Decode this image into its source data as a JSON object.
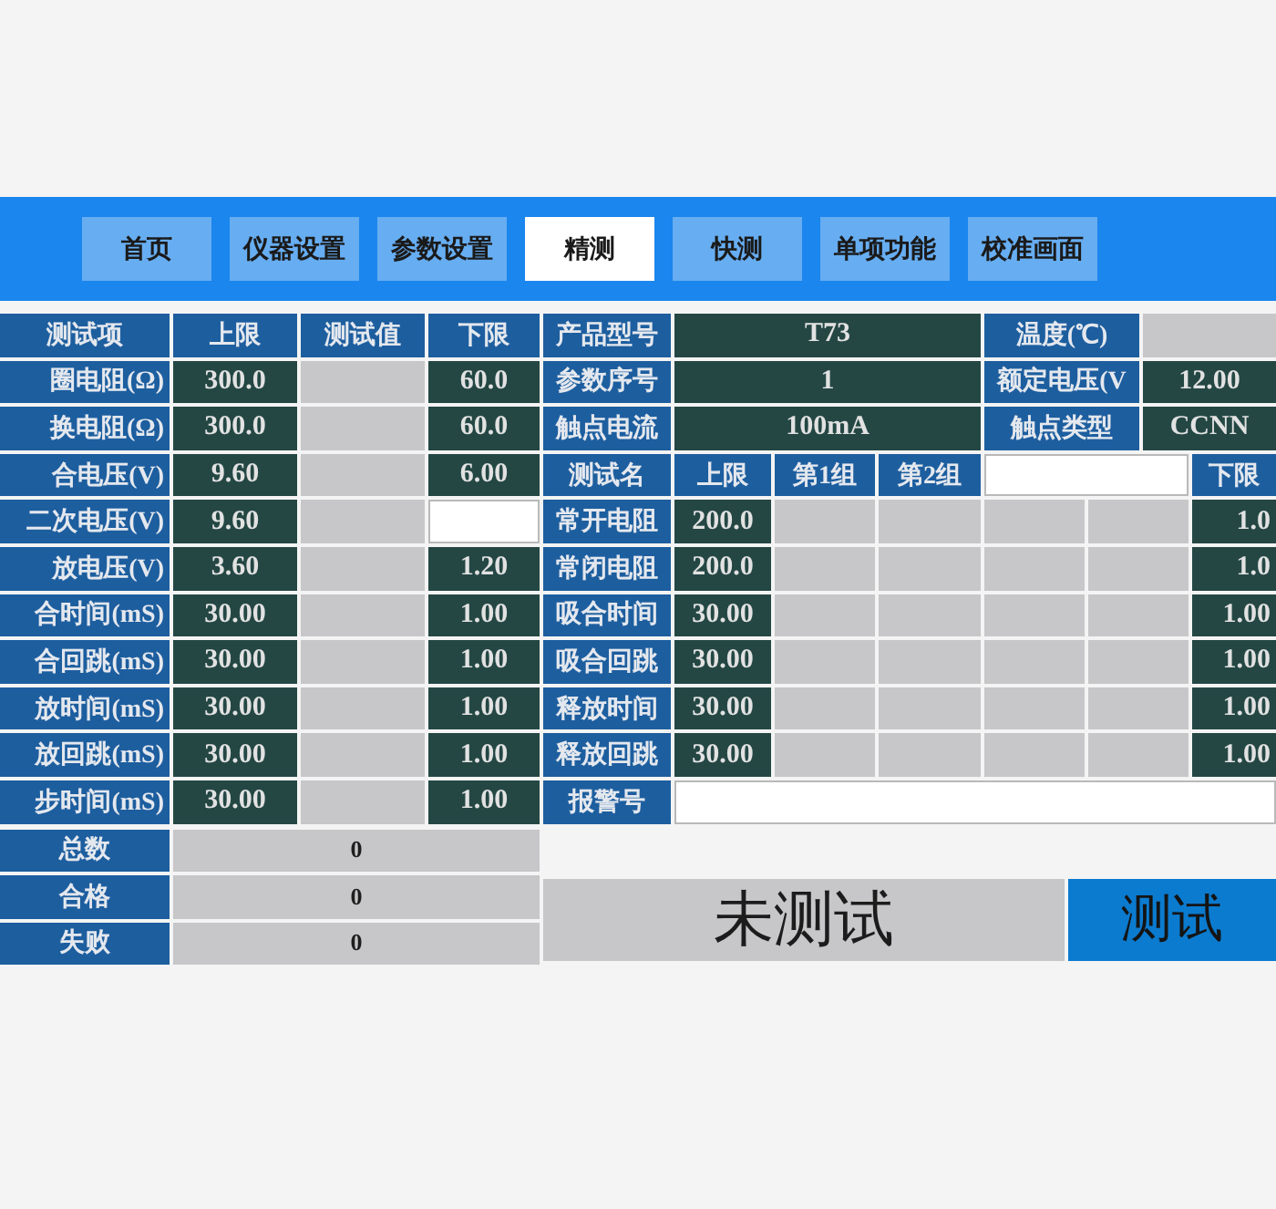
{
  "tabs": [
    {
      "label": "首页",
      "selected": false
    },
    {
      "label": "仪器设置",
      "selected": false
    },
    {
      "label": "参数设置",
      "selected": false
    },
    {
      "label": "精测",
      "selected": true
    },
    {
      "label": "快测",
      "selected": false
    },
    {
      "label": "单项功能",
      "selected": false
    },
    {
      "label": "校准画面",
      "selected": false
    }
  ],
  "limits_table": {
    "columns": [
      "测试项",
      "上限",
      "测试值",
      "下限"
    ],
    "rows": [
      {
        "item": "圈电阻(Ω)",
        "upper": "300.0",
        "lower": "60.0"
      },
      {
        "item": "换电阻(Ω)",
        "upper": "300.0",
        "lower": "60.0"
      },
      {
        "item": "合电压(V)",
        "upper": "9.60",
        "lower": "6.00"
      },
      {
        "item": "二次电压(V)",
        "upper": "9.60"
      },
      {
        "item": "放电压(V)",
        "upper": "3.60",
        "lower": "1.20"
      },
      {
        "item": "合时间(mS)",
        "upper": "30.00",
        "lower": "1.00"
      },
      {
        "item": "合回跳(mS)",
        "upper": "30.00",
        "lower": "1.00"
      },
      {
        "item": "放时间(mS)",
        "upper": "30.00",
        "lower": "1.00"
      },
      {
        "item": "放回跳(mS)",
        "upper": "30.00",
        "lower": "1.00"
      },
      {
        "item": "步时间(mS)",
        "upper": "30.00",
        "lower": "1.00"
      }
    ]
  },
  "summary": [
    {
      "label": "总数",
      "value": "0"
    },
    {
      "label": "合格",
      "value": "0"
    },
    {
      "label": "失败",
      "value": "0"
    }
  ],
  "product_info": [
    {
      "label": "产品型号",
      "value": "T73"
    },
    {
      "label": "温度(℃)"
    },
    {
      "label": "参数序号",
      "value": "1"
    },
    {
      "label": "额定电压(V",
      "value": "12.00"
    },
    {
      "label": "触点电流",
      "value": "100mA"
    },
    {
      "label": "触点类型",
      "value": "CCNN"
    }
  ],
  "group_table": {
    "columns": [
      "测试名",
      "上限",
      "第1组",
      "第2组"
    ],
    "lower_column": "下限",
    "rows": [
      {
        "name": "常开电阻",
        "upper": "200.0",
        "lower": "1.0"
      },
      {
        "name": "常闭电阻",
        "upper": "200.0",
        "lower": "1.0"
      },
      {
        "name": "吸合时间",
        "upper": "30.00",
        "lower": "1.00"
      },
      {
        "name": "吸合回跳",
        "upper": "30.00",
        "lower": "1.00"
      },
      {
        "name": "释放时间",
        "upper": "30.00",
        "lower": "1.00"
      },
      {
        "name": "释放回跳",
        "upper": "30.00",
        "lower": "1.00"
      }
    ]
  },
  "alarm": {
    "label": "报警号"
  },
  "status": {
    "text": "未测试"
  },
  "test_button": {
    "label": "测试"
  }
}
